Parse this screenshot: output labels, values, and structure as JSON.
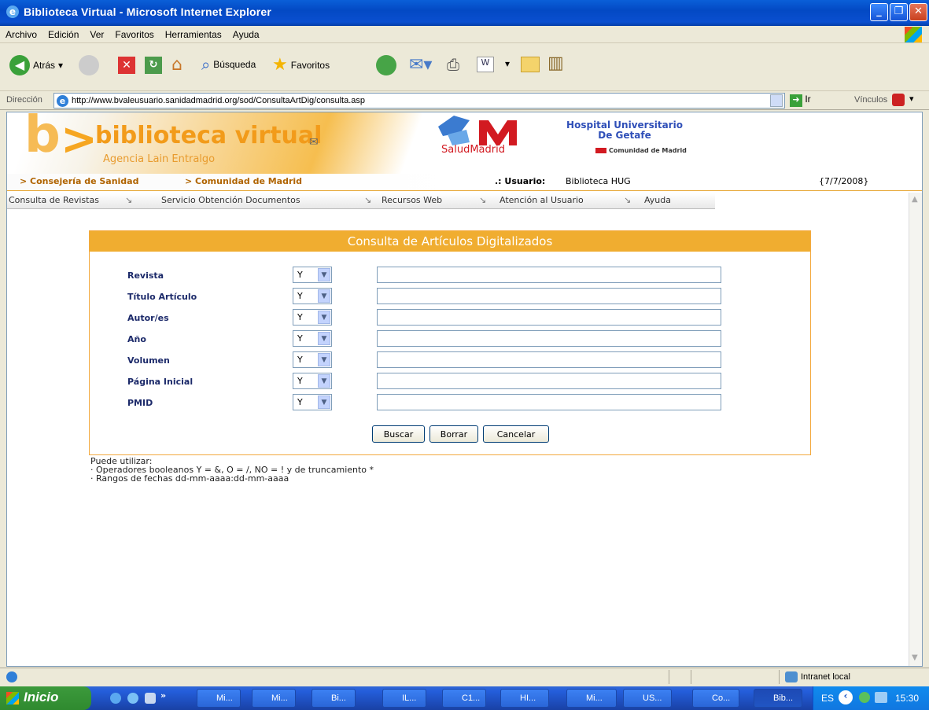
{
  "window": {
    "title": "Biblioteca Virtual - Microsoft Internet Explorer"
  },
  "menubar": [
    "Archivo",
    "Edición",
    "Ver",
    "Favoritos",
    "Herramientas",
    "Ayuda"
  ],
  "toolbar": {
    "back": "Atrás",
    "search": "Búsqueda",
    "favorites": "Favoritos"
  },
  "address": {
    "label": "Dirección",
    "url": "http://www.bvaleusuario.sanidadmadrid.org/sod/ConsultaArtDig/consulta.asp",
    "go": "Ir",
    "links": "Vínculos"
  },
  "header": {
    "logo_letter": "b>",
    "brand": "biblioteca virtual",
    "agency": "Agencia Lain Entralgo",
    "salud": "SaludMadrid",
    "hospital_line1": "Hospital Universitario",
    "hospital_line2": "De Getafe",
    "comunidad": "Comunidad de Madrid",
    "link_consejeria": "> Consejería de Sanidad",
    "link_comunidad": "> Comunidad de Madrid",
    "user_label": ".: Usuario:",
    "user_value": "Biblioteca HUG",
    "date": "{7/7/2008}"
  },
  "nav": [
    "Consulta de Revistas",
    "Servicio Obtención Documentos",
    "Recursos Web",
    "Atención al Usuario",
    "Ayuda"
  ],
  "form": {
    "title": "Consulta de Artículos Digitalizados",
    "rows": [
      {
        "label": "Revista",
        "op": "Y",
        "value": ""
      },
      {
        "label": "Título Artículo",
        "op": "Y",
        "value": ""
      },
      {
        "label": "Autor/es",
        "op": "Y",
        "value": ""
      },
      {
        "label": "Año",
        "op": "Y",
        "value": ""
      },
      {
        "label": "Volumen",
        "op": "Y",
        "value": ""
      },
      {
        "label": "Página Inicial",
        "op": "Y",
        "value": ""
      },
      {
        "label": "PMID",
        "op": "Y",
        "value": ""
      }
    ],
    "buttons": {
      "search": "Buscar",
      "clear": "Borrar",
      "cancel": "Cancelar"
    }
  },
  "help": {
    "intro": "Puede utilizar:",
    "line1": "· Operadores booleanos Y = &, O = /, NO = ! y de truncamiento *",
    "line2": "· Rangos de fechas dd-mm-aaaa:dd-mm-aaaa"
  },
  "status": {
    "zone": "Intranet local"
  },
  "taskbar": {
    "start": "Inicio",
    "tasks": [
      "Mi...",
      "Mi...",
      "Bi...",
      "IL...",
      "C1...",
      "HI...",
      "Mi...",
      "US...",
      "Co...",
      "Bib..."
    ],
    "lang": "ES",
    "time": "15:30"
  }
}
